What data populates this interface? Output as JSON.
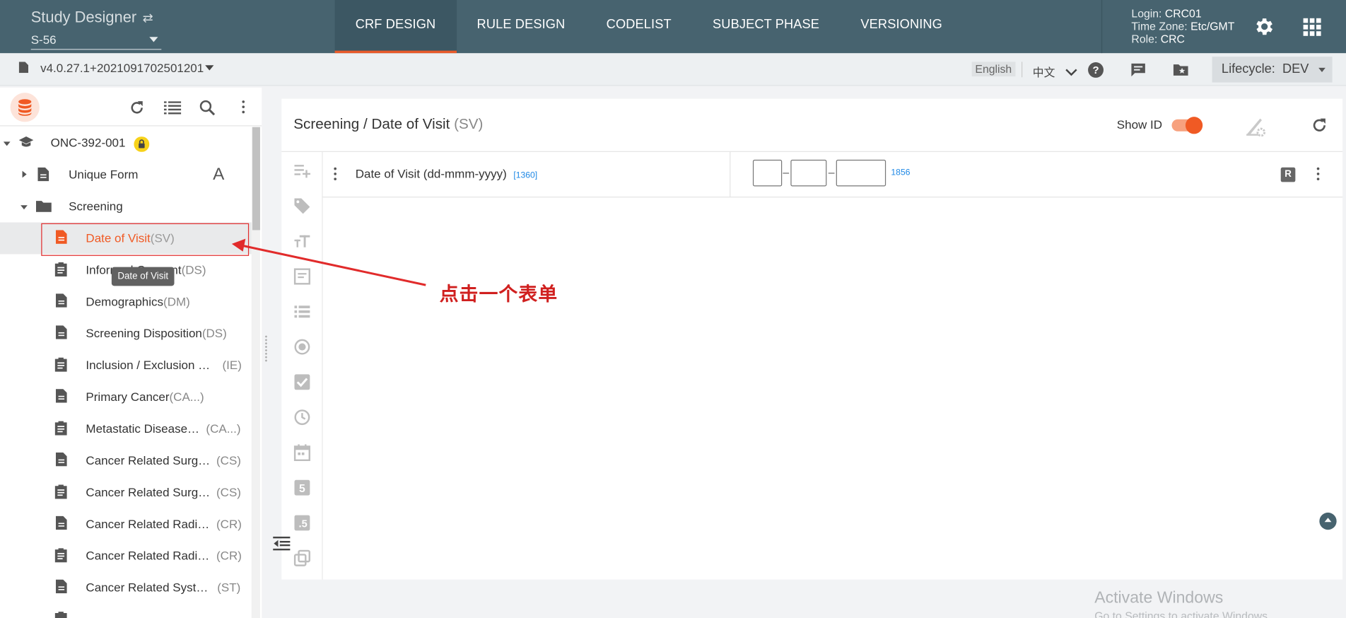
{
  "header": {
    "app_title": "Study Designer",
    "swap_glyph": "⇄",
    "study": "S-56",
    "tabs": [
      {
        "label": "CRF DESIGN",
        "active": true
      },
      {
        "label": "RULE DESIGN",
        "active": false
      },
      {
        "label": "CODELIST",
        "active": false
      },
      {
        "label": "SUBJECT PHASE",
        "active": false
      },
      {
        "label": "VERSIONING",
        "active": false
      }
    ],
    "user": {
      "login_key": "Login:",
      "login": "CRC01",
      "tz_key": "Time Zone:",
      "tz": "Etc/GMT",
      "role_key": "Role:",
      "role": "CRC"
    },
    "icons": [
      "settings-gear-icon",
      "apps-grid-icon"
    ]
  },
  "subbar": {
    "version": "v4.0.27.1+2021091702501201",
    "lang_en": "English",
    "lang_zh": "中文",
    "lifecycle_label": "Lifecycle:",
    "lifecycle_value": "DEV"
  },
  "sidebar": {
    "root": "ONC-392-001",
    "items": [
      {
        "label": "Unique Form",
        "code": "",
        "level": 1,
        "icon": "document-icon"
      },
      {
        "label": "Screening",
        "code": "",
        "level": 1,
        "icon": "folder-icon"
      },
      {
        "label": "Date of Visit",
        "code": "(SV)",
        "level": 2,
        "icon": "document-icon",
        "selected": true
      },
      {
        "label": "Informed Consent",
        "code": "(DS)",
        "level": 2,
        "icon": "clipboard-icon"
      },
      {
        "label": "Demographics",
        "code": "(DM)",
        "level": 2,
        "icon": "document-icon"
      },
      {
        "label": "Screening Disposition",
        "code": "(DS)",
        "level": 2,
        "icon": "document-icon"
      },
      {
        "label": "Inclusion / Exclusion …",
        "code": "(IE)",
        "level": 2,
        "icon": "clipboard-icon"
      },
      {
        "label": "Primary Cancer",
        "code": "(CA...)",
        "level": 2,
        "icon": "document-icon"
      },
      {
        "label": "Metastatic Disease…",
        "code": "(CA...)",
        "level": 2,
        "icon": "clipboard-icon"
      },
      {
        "label": "Cancer Related Surg…",
        "code": "(CS)",
        "level": 2,
        "icon": "document-icon"
      },
      {
        "label": "Cancer Related Surg…",
        "code": "(CS)",
        "level": 2,
        "icon": "clipboard-icon"
      },
      {
        "label": "Cancer Related Radi…",
        "code": "(CR)",
        "level": 2,
        "icon": "document-icon"
      },
      {
        "label": "Cancer Related Radi…",
        "code": "(CR)",
        "level": 2,
        "icon": "clipboard-icon"
      },
      {
        "label": "Cancer Related Syst…",
        "code": "(ST)",
        "level": 2,
        "icon": "document-icon"
      }
    ],
    "tooltip": "Date of Visit",
    "font_glyph": "A"
  },
  "main": {
    "breadcrumb": "Screening / Date of Visit",
    "breadcrumb_code": "(SV)",
    "show_id_label": "Show ID",
    "show_id_on": true,
    "field": {
      "label": "Date of Visit (dd-mmm-yyyy)",
      "id": "[1360]",
      "separator": "–",
      "date_id": "1856",
      "badge": "R"
    }
  },
  "annotation": {
    "text": "点击一个表单",
    "color": "#d0201f"
  },
  "watermark": {
    "line1": "Activate Windows",
    "line2": "Go to Settings to activate Windows."
  },
  "colors": {
    "header_bg": "#47636f",
    "accent": "#f05a24",
    "link": "#1e88e5"
  }
}
